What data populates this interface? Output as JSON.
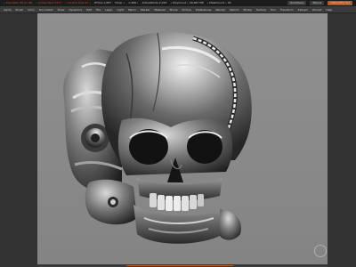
{
  "titlebar": {
    "stats": [
      "• Free Mem 36.67 GB",
      "• Active Mem 5377",
      "• Scratch Disk 47 •",
      "ZTime 1.087",
      "Timer •",
      "1,368 •",
      "ActivePoints 2,023",
      "• PolyCount • 29,067 MP",
      "• MeshCount • 92"
    ],
    "quicksave_label": "QuickSave",
    "menus_label": "Menus",
    "default_label": "DefaultZScript"
  },
  "menubar": {
    "items": [
      "Alpha",
      "Brush",
      "Color",
      "Document",
      "Draw",
      "Dynamics",
      "Edit",
      "File",
      "Layer",
      "Light",
      "Macro",
      "Marker",
      "Material",
      "Movie",
      "Picture",
      "Preferences",
      "Render",
      "Stencil",
      "Stroke",
      "Texture",
      "Tool",
      "Transform",
      "Zplugin",
      "Zscript",
      "Help"
    ]
  },
  "canvas": {
    "background": "#8c8c8c",
    "model": "skull-mesh"
  },
  "colors": {
    "accent": "#b9571f",
    "ui_dark": "#323232",
    "metal_highlight": "#e8e8e8",
    "metal_shadow": "#202020"
  }
}
